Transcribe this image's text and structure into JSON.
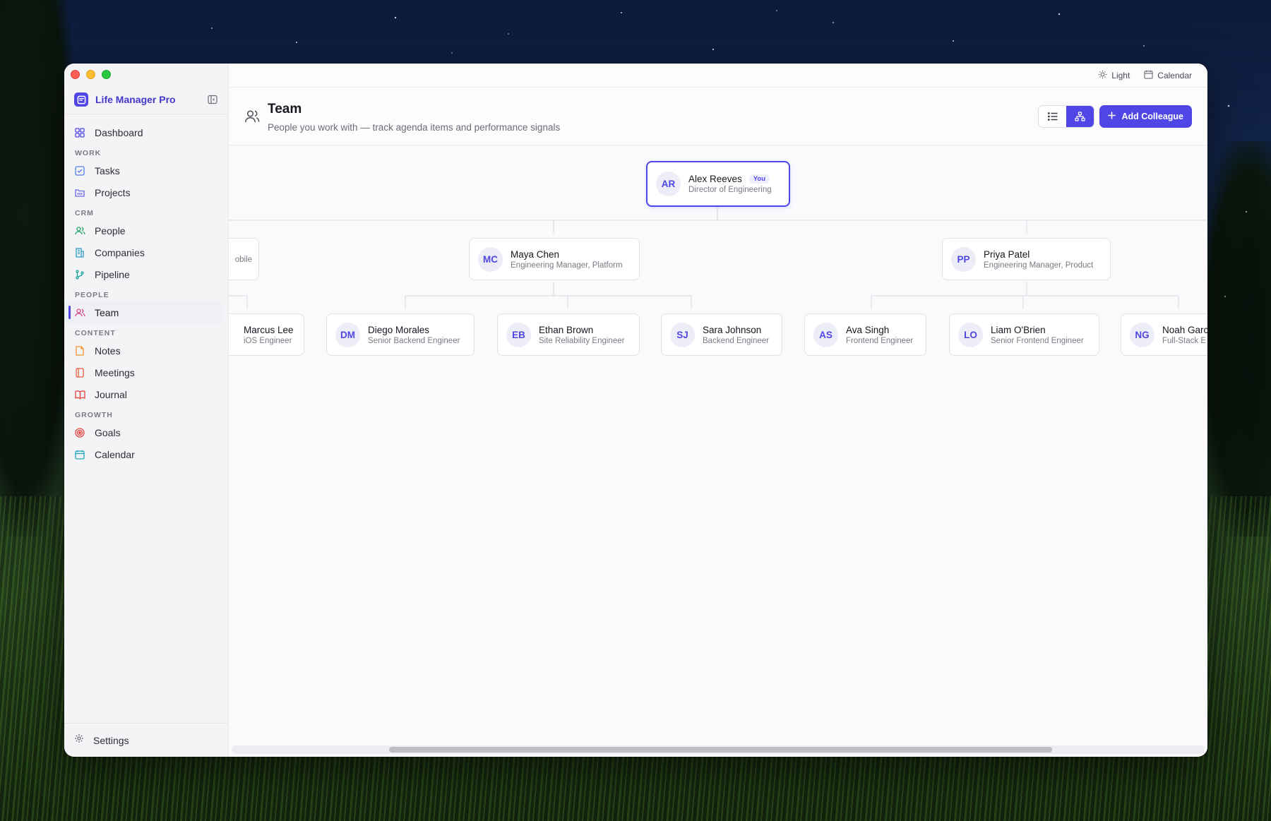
{
  "app": {
    "name": "Life Manager Pro"
  },
  "topbar": {
    "theme_label": "Light",
    "calendar_label": "Calendar"
  },
  "sidebar": {
    "dashboard": "Dashboard",
    "sections": {
      "work": "WORK",
      "crm": "CRM",
      "people": "PEOPLE",
      "content": "CONTENT",
      "growth": "GROWTH"
    },
    "items": {
      "tasks": "Tasks",
      "projects": "Projects",
      "people": "People",
      "companies": "Companies",
      "pipeline": "Pipeline",
      "team": "Team",
      "notes": "Notes",
      "meetings": "Meetings",
      "journal": "Journal",
      "goals": "Goals",
      "calendar": "Calendar"
    },
    "settings": "Settings",
    "active": "team"
  },
  "page": {
    "title": "Team",
    "subtitle": "People you work with — track agenda items and performance signals",
    "add_button": "Add Colleague",
    "view_mode": "org-chart"
  },
  "org": {
    "root": {
      "initials": "AR",
      "name": "Alex Reeves",
      "role": "Director of Engineering",
      "badge": "You"
    },
    "managers": [
      {
        "initials": "",
        "name": "",
        "role": "obile"
      },
      {
        "initials": "MC",
        "name": "Maya Chen",
        "role": "Engineering Manager, Platform"
      },
      {
        "initials": "PP",
        "name": "Priya Patel",
        "role": "Engineering Manager, Product"
      }
    ],
    "reports": [
      {
        "initials": "",
        "name": "Marcus Lee",
        "role": "iOS Engineer"
      },
      {
        "initials": "DM",
        "name": "Diego Morales",
        "role": "Senior Backend Engineer"
      },
      {
        "initials": "EB",
        "name": "Ethan Brown",
        "role": "Site Reliability Engineer"
      },
      {
        "initials": "SJ",
        "name": "Sara Johnson",
        "role": "Backend Engineer"
      },
      {
        "initials": "AS",
        "name": "Ava Singh",
        "role": "Frontend Engineer"
      },
      {
        "initials": "LO",
        "name": "Liam O'Brien",
        "role": "Senior Frontend Engineer"
      },
      {
        "initials": "NG",
        "name": "Noah Garc",
        "role": "Full-Stack E"
      }
    ]
  },
  "colors": {
    "accent": "#4f46e5",
    "accent_text": "#4338ca"
  }
}
